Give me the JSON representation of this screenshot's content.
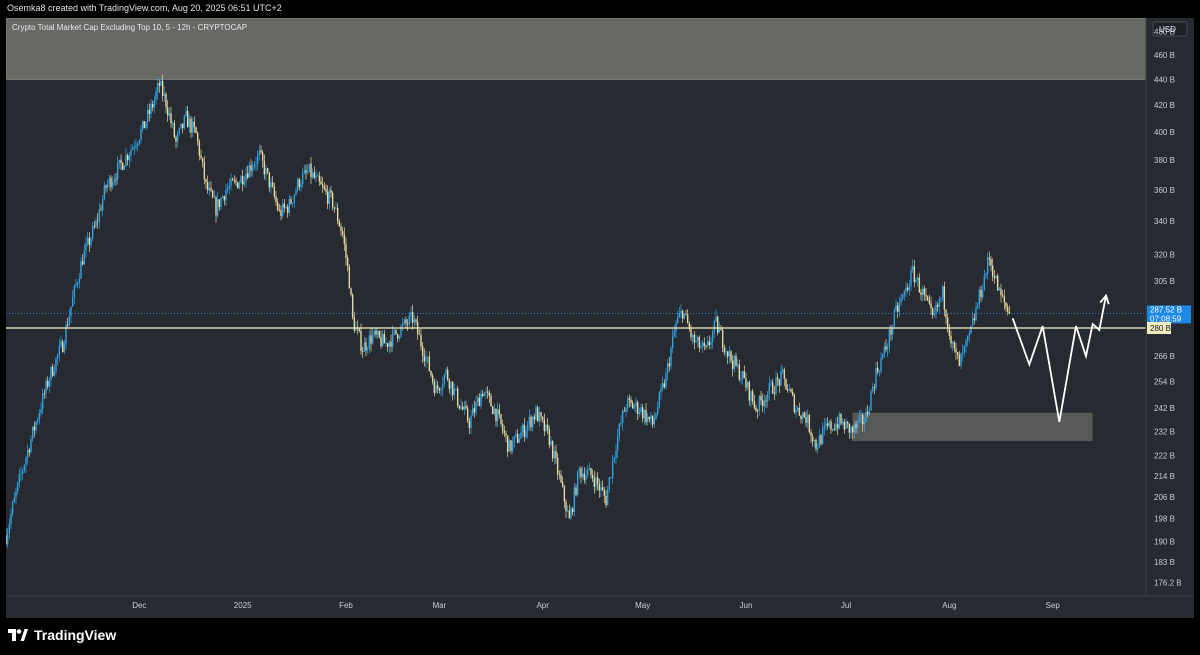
{
  "header": {
    "attribution": "Osemka8 created with TradingView.com, Aug 20, 2025 06:51 UTC+2"
  },
  "footer": {
    "brand": "TradingView",
    "brand_icon": "tradingview-logo-icon"
  },
  "colors": {
    "background": "#272a30",
    "up": "#2ea4e6",
    "down": "#e8d9a0",
    "level": "#f5f2c0",
    "zone": "#9e9e92",
    "price_tag": "#1e88e5"
  },
  "chart_data": {
    "type": "candlestick",
    "title": "Crypto Total Market Cap Excluding Top 10, 5 - 12h - CRYPTOCAP",
    "currency": "USD",
    "x": {
      "start": "2024-10-22",
      "end": "2025-09-29"
    },
    "xticks": [
      {
        "date": "2024-12-01",
        "label": "Dec"
      },
      {
        "date": "2025-01-01",
        "label": "2025"
      },
      {
        "date": "2025-02-01",
        "label": "Feb"
      },
      {
        "date": "2025-03-01",
        "label": "Mar"
      },
      {
        "date": "2025-04-01",
        "label": "Apr"
      },
      {
        "date": "2025-05-01",
        "label": "May"
      },
      {
        "date": "2025-06-01",
        "label": "Jun"
      },
      {
        "date": "2025-07-01",
        "label": "Jul"
      },
      {
        "date": "2025-08-01",
        "label": "Aug"
      },
      {
        "date": "2025-09-01",
        "label": "Sep"
      }
    ],
    "yscale": "log",
    "yticks": [
      {
        "value": 176.2,
        "label": "176.2 B"
      },
      {
        "value": 183,
        "label": "183 B"
      },
      {
        "value": 190,
        "label": "190 B"
      },
      {
        "value": 198,
        "label": "198 B"
      },
      {
        "value": 206,
        "label": "206 B"
      },
      {
        "value": 214,
        "label": "214 B"
      },
      {
        "value": 222,
        "label": "222 B"
      },
      {
        "value": 232,
        "label": "232 B"
      },
      {
        "value": 242,
        "label": "242 B"
      },
      {
        "value": 254,
        "label": "254 B"
      },
      {
        "value": 266,
        "label": "266 B"
      },
      {
        "value": 305,
        "label": "305 B"
      },
      {
        "value": 320,
        "label": "320 B"
      },
      {
        "value": 340,
        "label": "340 B"
      },
      {
        "value": 360,
        "label": "360 B"
      },
      {
        "value": 380,
        "label": "380 B"
      },
      {
        "value": 400,
        "label": "400 B"
      },
      {
        "value": 420,
        "label": "420 B"
      },
      {
        "value": 440,
        "label": "440 B"
      },
      {
        "value": 460,
        "label": "460 B"
      },
      {
        "value": 480,
        "label": "480 B"
      }
    ],
    "ylim": [
      172,
      492
    ],
    "current_price": {
      "label": "287.52 B",
      "value": 287.52,
      "countdown": "07:08:59"
    },
    "level_line": {
      "value": 280,
      "label": "280 B"
    },
    "zones": [
      {
        "x_from": "2024-10-22",
        "x_to": "2025-09-29",
        "y_low": 440,
        "y_high": 495
      },
      {
        "x_from": "2025-07-03",
        "x_to": "2025-09-13",
        "y_low": 228,
        "y_high": 240
      }
    ],
    "close_path": [
      [
        "2024-10-22",
        192
      ],
      [
        "2024-10-26",
        212
      ],
      [
        "2024-10-31",
        236
      ],
      [
        "2024-11-04",
        256
      ],
      [
        "2024-11-08",
        272
      ],
      [
        "2024-11-11",
        295
      ],
      [
        "2024-11-14",
        318
      ],
      [
        "2024-11-18",
        338
      ],
      [
        "2024-11-21",
        362
      ],
      [
        "2024-11-25",
        375
      ],
      [
        "2024-11-28",
        386
      ],
      [
        "2024-12-02",
        402
      ],
      [
        "2024-12-05",
        420
      ],
      [
        "2024-12-07",
        436
      ],
      [
        "2024-12-09",
        422
      ],
      [
        "2024-12-12",
        392
      ],
      [
        "2024-12-15",
        410
      ],
      [
        "2024-12-18",
        398
      ],
      [
        "2024-12-21",
        362
      ],
      [
        "2024-12-24",
        348
      ],
      [
        "2024-12-27",
        360
      ],
      [
        "2024-12-31",
        366
      ],
      [
        "2025-01-03",
        375
      ],
      [
        "2025-01-06",
        383
      ],
      [
        "2025-01-09",
        365
      ],
      [
        "2025-01-12",
        345
      ],
      [
        "2025-01-15",
        350
      ],
      [
        "2025-01-18",
        366
      ],
      [
        "2025-01-21",
        372
      ],
      [
        "2025-01-25",
        360
      ],
      [
        "2025-01-28",
        352
      ],
      [
        "2025-01-31",
        332
      ],
      [
        "2025-02-02",
        305
      ],
      [
        "2025-02-03",
        284
      ],
      [
        "2025-02-06",
        270
      ],
      [
        "2025-02-09",
        276
      ],
      [
        "2025-02-13",
        272
      ],
      [
        "2025-02-17",
        279
      ],
      [
        "2025-02-21",
        285
      ],
      [
        "2025-02-24",
        270
      ],
      [
        "2025-02-28",
        250
      ],
      [
        "2025-03-03",
        258
      ],
      [
        "2025-03-07",
        244
      ],
      [
        "2025-03-10",
        236
      ],
      [
        "2025-03-14",
        250
      ],
      [
        "2025-03-18",
        240
      ],
      [
        "2025-03-22",
        225
      ],
      [
        "2025-03-26",
        232
      ],
      [
        "2025-03-30",
        240
      ],
      [
        "2025-04-03",
        229
      ],
      [
        "2025-04-06",
        213
      ],
      [
        "2025-04-09",
        197
      ],
      [
        "2025-04-12",
        216
      ],
      [
        "2025-04-16",
        214
      ],
      [
        "2025-04-20",
        205
      ],
      [
        "2025-04-23",
        227
      ],
      [
        "2025-04-26",
        244
      ],
      [
        "2025-04-30",
        242
      ],
      [
        "2025-05-04",
        235
      ],
      [
        "2025-05-08",
        256
      ],
      [
        "2025-05-11",
        282
      ],
      [
        "2025-05-13",
        289
      ],
      [
        "2025-05-16",
        274
      ],
      [
        "2025-05-20",
        268
      ],
      [
        "2025-05-23",
        282
      ],
      [
        "2025-05-27",
        266
      ],
      [
        "2025-05-31",
        256
      ],
      [
        "2025-06-04",
        242
      ],
      [
        "2025-06-08",
        250
      ],
      [
        "2025-06-12",
        256
      ],
      [
        "2025-06-16",
        242
      ],
      [
        "2025-06-19",
        238
      ],
      [
        "2025-06-22",
        226
      ],
      [
        "2025-06-25",
        233
      ],
      [
        "2025-06-29",
        236
      ],
      [
        "2025-07-03",
        232
      ],
      [
        "2025-07-07",
        238
      ],
      [
        "2025-07-10",
        258
      ],
      [
        "2025-07-13",
        270
      ],
      [
        "2025-07-16",
        288
      ],
      [
        "2025-07-19",
        300
      ],
      [
        "2025-07-21",
        310
      ],
      [
        "2025-07-24",
        298
      ],
      [
        "2025-07-27",
        284
      ],
      [
        "2025-07-30",
        298
      ],
      [
        "2025-08-02",
        270
      ],
      [
        "2025-08-04",
        262
      ],
      [
        "2025-08-07",
        275
      ],
      [
        "2025-08-10",
        296
      ],
      [
        "2025-08-13",
        318
      ],
      [
        "2025-08-16",
        298
      ],
      [
        "2025-08-19",
        287.5
      ]
    ],
    "projection": [
      [
        "2025-08-20",
        285
      ],
      [
        "2025-08-25",
        262
      ],
      [
        "2025-08-29",
        281
      ],
      [
        "2025-09-03",
        236
      ],
      [
        "2025-09-08",
        281
      ],
      [
        "2025-09-11",
        266
      ],
      [
        "2025-09-13",
        282
      ],
      [
        "2025-09-15",
        279
      ],
      [
        "2025-09-17",
        297
      ]
    ]
  }
}
